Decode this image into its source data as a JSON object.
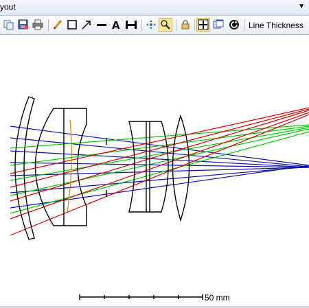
{
  "window": {
    "title": "yout"
  },
  "toolbar": {
    "tools": [
      {
        "name": "copy-icon",
        "active": false
      },
      {
        "name": "save-icon",
        "active": false
      },
      {
        "name": "print-icon",
        "active": false
      },
      {
        "name": "pencil-icon",
        "active": false
      },
      {
        "name": "rectangle-icon",
        "active": false
      },
      {
        "name": "arrow-icon",
        "active": false
      },
      {
        "name": "line-icon",
        "active": false
      },
      {
        "name": "text-icon",
        "active": false
      },
      {
        "name": "dimension-icon",
        "active": false
      },
      {
        "name": "pan-icon",
        "active": false
      },
      {
        "name": "zoom-icon",
        "active": true
      },
      {
        "name": "lock-icon",
        "active": false
      },
      {
        "name": "fit-icon",
        "active": true
      },
      {
        "name": "window-icon",
        "active": false
      },
      {
        "name": "refresh-icon",
        "active": false
      }
    ],
    "line_thickness_label": "Line Thickness"
  },
  "layout": {
    "scale_bar_label": "50 mm",
    "ray_colors": {
      "field1": "#1010b0",
      "field2": "#00cc00",
      "field3": "#dd0000"
    },
    "element_color": "#000000",
    "stop_color": "#e08a00"
  }
}
